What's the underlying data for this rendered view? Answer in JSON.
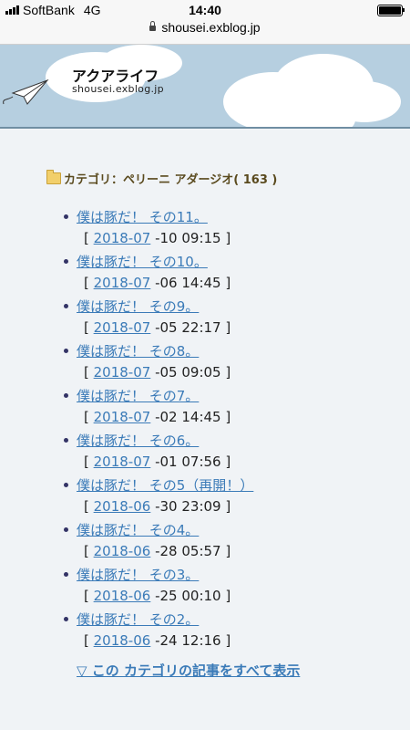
{
  "status_bar": {
    "carrier": "SoftBank",
    "network": "4G",
    "time": "14:40"
  },
  "browser": {
    "url": "shousei.exblog.jp"
  },
  "header": {
    "site_title": "アクアライフ",
    "site_url": "shousei.exblog.jp"
  },
  "category": {
    "label": "カテゴリ：ペリーニ アダージオ( 163 )",
    "icon": "folder-icon"
  },
  "posts": [
    {
      "title": "僕は豚だ！ その11。",
      "month": "2018-07",
      "datetime": "-10 09:15"
    },
    {
      "title": "僕は豚だ！ その10。",
      "month": "2018-07",
      "datetime": "-06 14:45"
    },
    {
      "title": "僕は豚だ！ その9。",
      "month": "2018-07",
      "datetime": "-05 22:17"
    },
    {
      "title": "僕は豚だ！ その8。",
      "month": "2018-07",
      "datetime": "-05 09:05"
    },
    {
      "title": "僕は豚だ！ その7。",
      "month": "2018-07",
      "datetime": "-02 14:45"
    },
    {
      "title": "僕は豚だ！ その6。",
      "month": "2018-07",
      "datetime": "-01 07:56"
    },
    {
      "title": "僕は豚だ！ その5（再開！）",
      "month": "2018-06",
      "datetime": "-30 23:09"
    },
    {
      "title": "僕は豚だ！ その4。",
      "month": "2018-06",
      "datetime": "-28 05:57"
    },
    {
      "title": "僕は豚だ！ その3。",
      "month": "2018-06",
      "datetime": "-25 00:10"
    },
    {
      "title": "僕は豚だ！ その2。",
      "month": "2018-06",
      "datetime": "-24 12:16"
    }
  ],
  "footer_link": "▽ この カテゴリの記事をすべて表示",
  "colors": {
    "link": "#3b7bb8",
    "banner": "#b6cfe0",
    "background": "#f0f3f6"
  }
}
